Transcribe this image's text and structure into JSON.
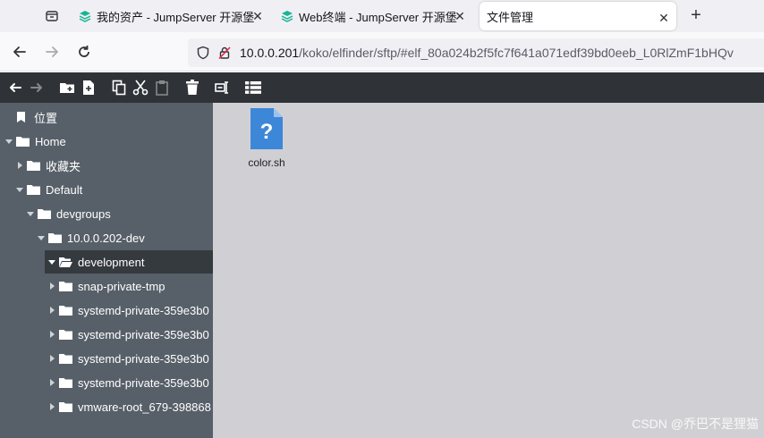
{
  "browser": {
    "tabs": [
      {
        "label": "我的资产 - JumpServer 开源堡",
        "active": false
      },
      {
        "label": "Web终端 - JumpServer 开源堡",
        "active": false
      },
      {
        "label": "文件管理",
        "active": true
      }
    ],
    "url_host": "10.0.0.201",
    "url_path": "/koko/elfinder/sftp/#elf_80a024b2f5fc7f641a071edf39bd0eeb_L0RlZmF1bHQv"
  },
  "sidebar": {
    "places_label": "位置",
    "tree": [
      {
        "label": "Home",
        "expanded": true
      },
      {
        "label": "收藏夹",
        "expanded": false
      },
      {
        "label": "Default",
        "expanded": true
      },
      {
        "label": "devgroups",
        "expanded": true
      },
      {
        "label": "10.0.0.202-dev",
        "expanded": true
      },
      {
        "label": "development",
        "expanded": true,
        "selected": true
      },
      {
        "label": "snap-private-tmp",
        "expanded": false
      },
      {
        "label": "systemd-private-359e3b0",
        "expanded": false
      },
      {
        "label": "systemd-private-359e3b0",
        "expanded": false
      },
      {
        "label": "systemd-private-359e3b0",
        "expanded": false
      },
      {
        "label": "systemd-private-359e3b0",
        "expanded": false
      },
      {
        "label": "vmware-root_679-398868",
        "expanded": false
      }
    ]
  },
  "files": [
    {
      "name": "color.sh",
      "icon": "unknown-file-icon"
    }
  ],
  "watermark": "CSDN @乔巴不是狸猫",
  "colors": {
    "toolbar_bg": "#2f3337",
    "sidebar_bg": "#576068",
    "selected_bg": "#353a3f",
    "file_area_bg": "#d0d0d4",
    "file_icon": "#3d87d8"
  }
}
